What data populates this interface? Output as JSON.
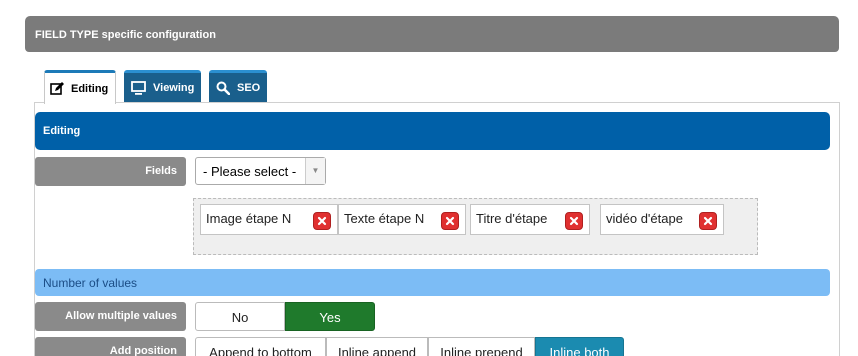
{
  "header": {
    "title": "FIELD TYPE specific configuration"
  },
  "tabs": [
    {
      "label": "Editing",
      "icon": "edit-icon",
      "active": true
    },
    {
      "label": "Viewing",
      "icon": "monitor-icon",
      "active": false
    },
    {
      "label": "SEO",
      "icon": "search-icon",
      "active": false
    }
  ],
  "editing_section": {
    "title": "Editing"
  },
  "fields": {
    "label": "Fields",
    "select_value": "- Please select -",
    "chips": [
      {
        "label": "Image étape N"
      },
      {
        "label": "Texte étape N"
      },
      {
        "label": "Titre d'étape"
      },
      {
        "label": "vidéo d'étape"
      }
    ]
  },
  "number_of_values": {
    "title": "Number of values"
  },
  "allow_multiple": {
    "label": "Allow multiple values",
    "options": [
      "No",
      "Yes"
    ],
    "selected": "Yes"
  },
  "add_position": {
    "label": "Add position",
    "options": [
      "Append to bottom",
      "Inline append",
      "Inline prepend",
      "Inline both"
    ],
    "selected": "Inline both"
  },
  "colors": {
    "primary_blue": "#0060a8",
    "light_blue": "#7cbcf5",
    "yes_green": "#1f7a2c",
    "selected_teal": "#1b8bb0",
    "remove_red": "#e03030"
  }
}
